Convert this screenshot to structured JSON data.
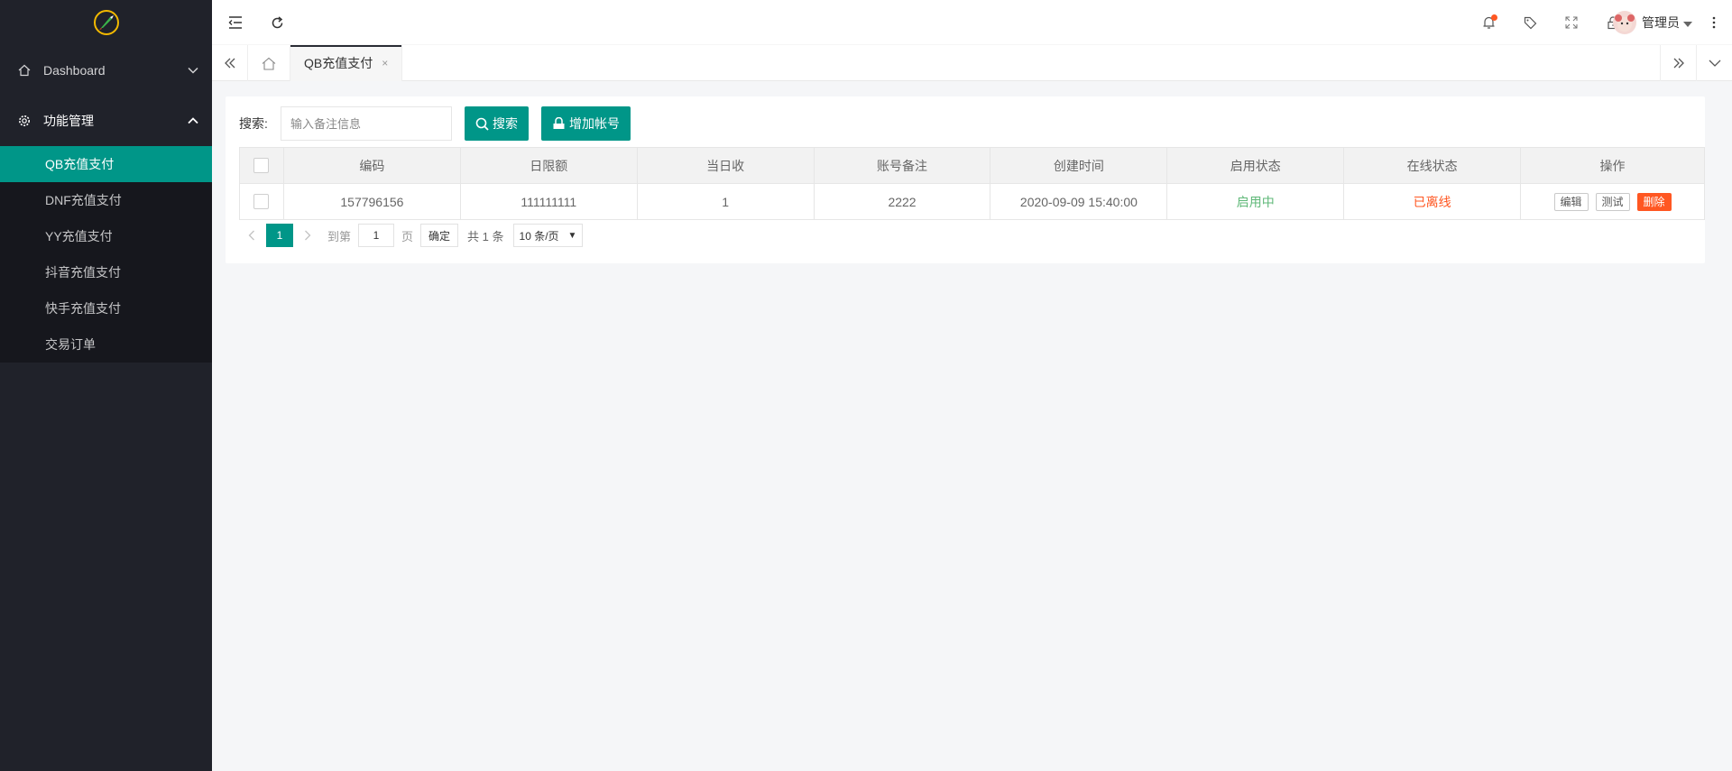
{
  "sidebar": {
    "groups": [
      {
        "label": "Dashboard",
        "icon": "home-icon",
        "expanded": false
      },
      {
        "label": "功能管理",
        "icon": "gear-icon",
        "expanded": true
      }
    ],
    "items": [
      {
        "label": "QB充值支付",
        "active": true
      },
      {
        "label": "DNF充值支付",
        "active": false
      },
      {
        "label": "YY充值支付",
        "active": false
      },
      {
        "label": "抖音充值支付",
        "active": false
      },
      {
        "label": "快手充值支付",
        "active": false
      },
      {
        "label": "交易订单",
        "active": false
      }
    ]
  },
  "header": {
    "user_name": "管理员",
    "icons": [
      "menu-fold-icon",
      "refresh-icon",
      "bell-icon",
      "tag-icon",
      "fullscreen-icon",
      "lock-icon",
      "more-icon"
    ]
  },
  "tabs": {
    "items": [
      {
        "label": "QB充值支付",
        "close": "×"
      }
    ]
  },
  "search": {
    "label": "搜索:",
    "placeholder": "输入备注信息",
    "search_button": "搜索",
    "add_button": "增加帐号"
  },
  "table": {
    "headers": [
      "编码",
      "日限额",
      "当日收",
      "账号备注",
      "创建时间",
      "启用状态",
      "在线状态",
      "操作"
    ],
    "rows": [
      {
        "code": "157796156",
        "daily_limit": "111111111",
        "today_received": "1",
        "remark": "2222",
        "created": "2020-09-09 15:40:00",
        "enabled": "启用中",
        "online": "已离线",
        "actions": [
          "编辑",
          "测试",
          "删除"
        ]
      }
    ]
  },
  "pager": {
    "current": "1",
    "goto_label": "到第",
    "goto_value": "1",
    "page_unit": "页",
    "confirm": "确定",
    "total": "共 1 条",
    "page_size": "10 条/页"
  },
  "colors": {
    "accent": "#009688",
    "sidebar": "#20222a",
    "danger": "#ff5722",
    "success": "#5fb878"
  }
}
